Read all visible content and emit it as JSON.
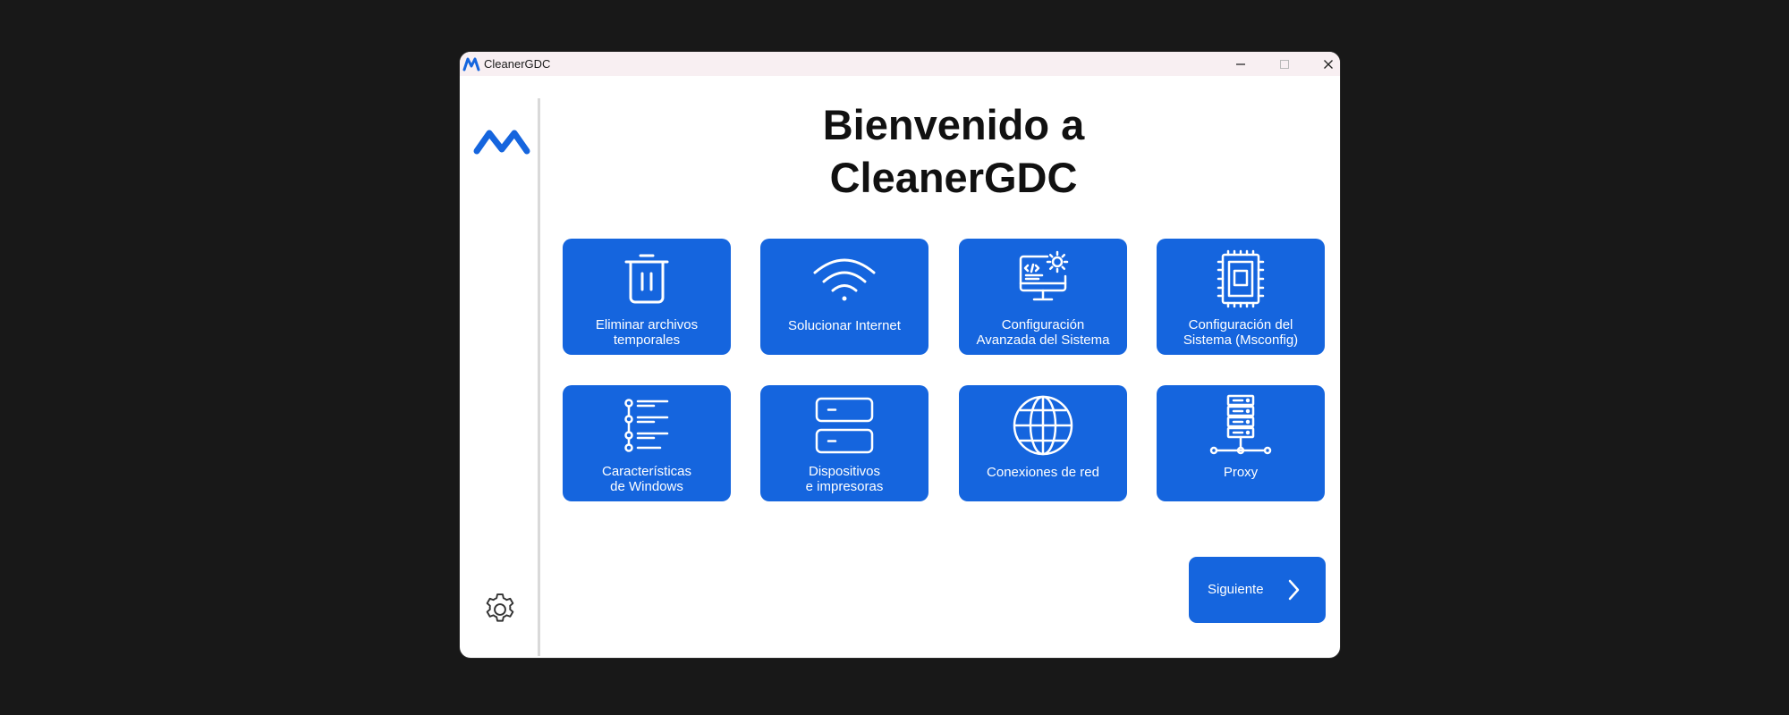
{
  "window": {
    "title": "CleanerGDC",
    "controls": {
      "minimize": "minimize-icon",
      "maximize": "maximize-icon",
      "close": "close-icon"
    }
  },
  "sidebar": {
    "logo": "app-logo",
    "settings_icon": "gear-icon"
  },
  "main": {
    "heading_line1": "Bienvenido a",
    "heading_line2": "CleanerGDC",
    "tiles": [
      {
        "label": "Eliminar archivos\ntemporales",
        "icon": "trash-icon"
      },
      {
        "label": "Solucionar Internet",
        "icon": "wifi-icon"
      },
      {
        "label": "Configuración\nAvanzada del Sistema",
        "icon": "monitor-settings-icon"
      },
      {
        "label": "Configuración del\nSistema (Msconfig)",
        "icon": "cpu-chip-icon"
      },
      {
        "label": "Características\nde Windows",
        "icon": "feature-list-icon"
      },
      {
        "label": "Dispositivos\ne impresoras",
        "icon": "devices-icon"
      },
      {
        "label": "Conexiones de red",
        "icon": "globe-icon"
      },
      {
        "label": "Proxy",
        "icon": "server-network-icon"
      }
    ],
    "next_button": {
      "label": "Siguiente",
      "icon": "chevron-right-icon"
    }
  },
  "colors": {
    "accent": "#1565de",
    "background": "#181818",
    "titlebar": "#f8eff2",
    "window": "#ffffff"
  }
}
